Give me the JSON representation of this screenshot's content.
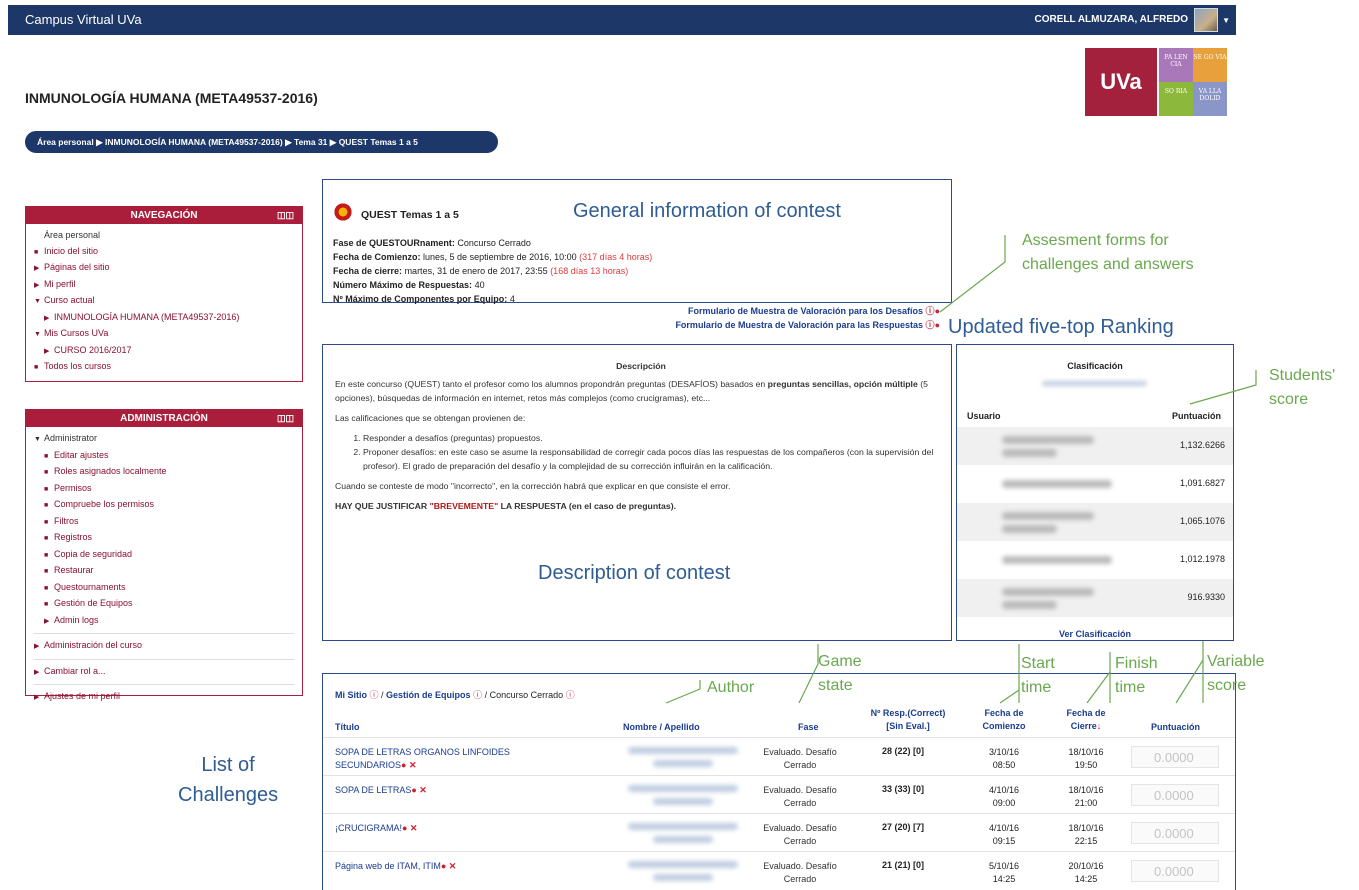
{
  "topbar": {
    "brand": "Campus Virtual UVa",
    "user": "CORELL ALMUZARA, ALFREDO"
  },
  "course_title": "INMUNOLOGÍA HUMANA (META49537-2016)",
  "logo": {
    "uva": "UVa",
    "tiles": [
      {
        "text": "PA LEN CIA",
        "color": "#a878b8"
      },
      {
        "text": "SE GO VIA",
        "color": "#e8a03c"
      },
      {
        "text": "SO RIA",
        "color": "#8cb83c"
      },
      {
        "text": "VA LLA DOLID",
        "color": "#8a95c8"
      }
    ]
  },
  "breadcrumb": {
    "items": [
      "Área personal",
      "INMUNOLOGÍA HUMANA (META49537-2016)",
      "Tema 31",
      "QUEST Temas 1 a 5"
    ]
  },
  "nav_block": {
    "title": "NAVEGACIÓN",
    "items": [
      {
        "label": "Área personal",
        "marker": ""
      },
      {
        "label": "Inicio del sitio",
        "marker": "■"
      },
      {
        "label": "Páginas del sitio",
        "marker": "▶"
      },
      {
        "label": "Mi perfil",
        "marker": "▶"
      },
      {
        "label": "Curso actual",
        "marker": "▼"
      },
      {
        "label": "INMUNOLOGÍA HUMANA (META49537-2016)",
        "marker": "▶"
      },
      {
        "label": "Mis Cursos UVa",
        "marker": "▼"
      },
      {
        "label": "CURSO 2016/2017",
        "marker": "▶"
      },
      {
        "label": "Todos los cursos",
        "marker": "■"
      }
    ]
  },
  "admin_block": {
    "title": "ADMINISTRACIÓN",
    "items": [
      {
        "label": "Administrator",
        "marker": "▼"
      },
      {
        "label": "Editar ajustes",
        "marker": "■"
      },
      {
        "label": "Roles asignados localmente",
        "marker": "■"
      },
      {
        "label": "Permisos",
        "marker": "■"
      },
      {
        "label": "Compruebe los permisos",
        "marker": "■"
      },
      {
        "label": "Filtros",
        "marker": "■"
      },
      {
        "label": "Registros",
        "marker": "■"
      },
      {
        "label": "Copia de seguridad",
        "marker": "■"
      },
      {
        "label": "Restaurar",
        "marker": "■"
      },
      {
        "label": "Questournaments",
        "marker": "■"
      },
      {
        "label": "Gestión de Equipos",
        "marker": "■"
      },
      {
        "label": "Admin logs",
        "marker": "▶"
      },
      {
        "label": "Administración del curso",
        "marker": "▶"
      },
      {
        "label": "Cambiar rol a...",
        "marker": "▶"
      },
      {
        "label": "Ajustes de mi perfil",
        "marker": "▶"
      }
    ]
  },
  "contest": {
    "title": "QUEST Temas 1 a 5",
    "phase_label": "Fase de QUESTOURnament:",
    "phase_value": "Concurso Cerrado",
    "start_label": "Fecha de Comienzo:",
    "start_value": "lunes, 5 de septiembre de 2016, 10:00",
    "start_ago": "(317 días 4 horas)",
    "end_label": "Fecha de cierre:",
    "end_value": "martes, 31 de enero de 2017, 23:55",
    "end_ago": "(168 días 13 horas)",
    "max_resp_label": "Número Máximo de Respuestas:",
    "max_resp_value": "40",
    "max_team_label": "Nº Máximo de Componentes por Equipo:",
    "max_team_value": "4",
    "form_challenges": "Formulario de Muestra de Valoración para los Desafíos",
    "form_answers": "Formulario de Muestra de Valoración para las Respuestas"
  },
  "description": {
    "heading": "Descripción",
    "p1_a": "En este concurso (QUEST) tanto el profesor como los alumnos propondrán preguntas (DESAFÍOS) basados en ",
    "p1_b": "preguntas sencillas, opción múltiple",
    "p1_c": " (5 opciones), búsquedas de información en internet, retos más complejos (como crucigramas), etc...",
    "p2": "Las calificaciones que se obtengan provienen de:",
    "li1": "Responder a desafíos (preguntas) propuestos.",
    "li2": "Proponer desafíos: en este caso se asume la responsabilidad de corregir cada pocos días las respuestas de los compañeros (con la supervisión del profesor). El grado de preparación del desafío y la complejidad de su corrección influirán en la calificación.",
    "p3": "Cuando se conteste de modo \"incorrecto\", en la corrección habrá que explicar en que consiste el error.",
    "p4_a": "HAY QUE JUSTIFICAR ",
    "p4_b": "\"BREVEMENTE\"",
    "p4_c": " LA RESPUESTA (en el caso de preguntas)."
  },
  "ranking": {
    "heading": "Clasificación",
    "col_user": "Usuario",
    "col_score": "Puntuación",
    "scores": [
      "1,132.6266",
      "1,091.6827",
      "1,065.1076",
      "1,012.1978",
      "916.9330"
    ],
    "link": "Ver Clasificación"
  },
  "challenges": {
    "crumb_site": "Mi Sitio",
    "crumb_teams": "Gestión de Equipos",
    "crumb_closed": "Concurso Cerrado",
    "col_title": "Título",
    "col_author": "Nombre / Apellido",
    "col_phase": "Fase",
    "col_resp_1": "Nº Resp.(Correct)",
    "col_resp_2": "[Sin Eval.]",
    "col_start_1": "Fecha de",
    "col_start_2": "Comienzo",
    "col_end_1": "Fecha de",
    "col_end_2": "Cierre",
    "col_score": "Puntuación",
    "rows": [
      {
        "title": "SOPA DE LETRAS ORGANOS LINFOIDES SECUNDARIOS",
        "phase": "Evaluado. Desafío Cerrado",
        "resp": "28 (22) [0]",
        "start_d": "3/10/16",
        "start_t": "08:50",
        "end_d": "18/10/16",
        "end_t": "19:50",
        "score": "0.0000"
      },
      {
        "title": "SOPA DE LETRAS",
        "phase": "Evaluado. Desafío Cerrado",
        "resp": "33 (33) [0]",
        "start_d": "4/10/16",
        "start_t": "09:00",
        "end_d": "18/10/16",
        "end_t": "21:00",
        "score": "0.0000"
      },
      {
        "title": "¡CRUCIGRAMA!",
        "phase": "Evaluado. Desafío Cerrado",
        "resp": "27 (20) [7]",
        "start_d": "4/10/16",
        "start_t": "09:15",
        "end_d": "18/10/16",
        "end_t": "22:15",
        "score": "0.0000"
      },
      {
        "title": "Página web de ITAM, ITIM",
        "phase": "Evaluado. Desafío Cerrado",
        "resp": "21 (21) [0]",
        "start_d": "5/10/16",
        "start_t": "14:25",
        "end_d": "20/10/16",
        "end_t": "14:25",
        "score": "0.0000"
      }
    ]
  },
  "annotations": {
    "general": "General information of contest",
    "forms": "Assesment forms for\nchallenges and answers",
    "ranking": "Updated five-top Ranking",
    "students_score": "Students'\nscore",
    "description": "Description of contest",
    "list": "List of\nChallenges",
    "author": "Author",
    "game_state": "Game\nstate",
    "start_time": "Start\ntime",
    "finish_time": "Finish\ntime",
    "variable_score": "Variable\nscore"
  },
  "colors": {
    "navy": "#1d3768",
    "crimson": "#aa1d3b",
    "annotation_blue": "#2f5c94",
    "annotation_green": "#6aa84f"
  }
}
